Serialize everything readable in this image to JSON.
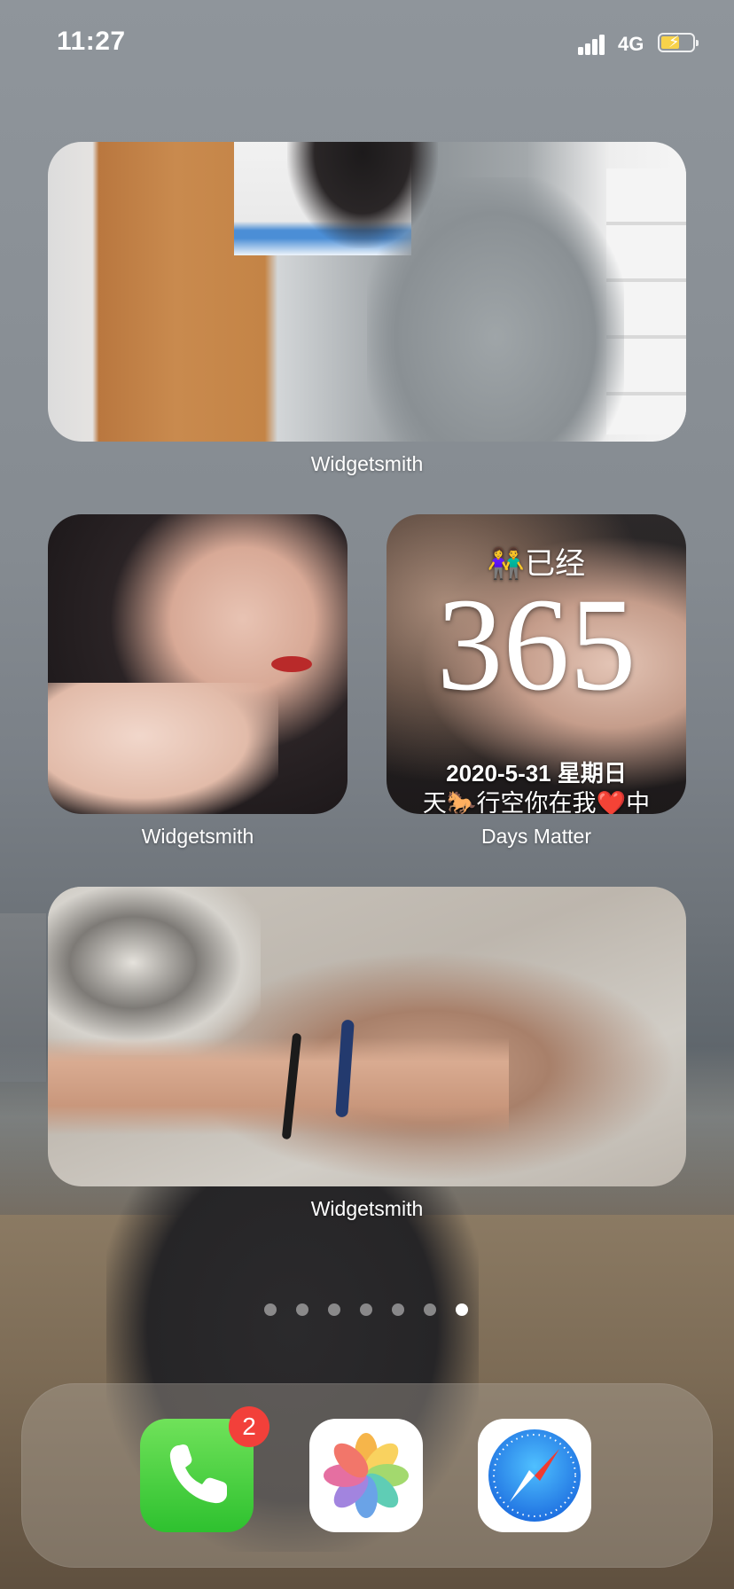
{
  "status_bar": {
    "time": "11:27",
    "network": "4G",
    "charging": true
  },
  "widgets": [
    {
      "label": "Widgetsmith",
      "app": "Widgetsmith"
    },
    {
      "label": "Widgetsmith",
      "app": "Widgetsmith"
    },
    {
      "label": "Days Matter",
      "app": "Days Matter",
      "emoji": "👫",
      "prefix": "已经",
      "count": "365",
      "date_line": "2020-5-31 星期日",
      "caption_start": "天",
      "caption_emoji_horse": "🐎",
      "caption_middle": "行空你在我",
      "caption_emoji_heart": "❤️",
      "caption_end": "中"
    },
    {
      "label": "Widgetsmith",
      "app": "Widgetsmith"
    }
  ],
  "page_dots": {
    "count": 7,
    "active_index": 6
  },
  "dock": {
    "apps": [
      {
        "name": "Phone",
        "icon": "phone-icon",
        "badge": "2"
      },
      {
        "name": "Photos",
        "icon": "photos-icon"
      },
      {
        "name": "Safari",
        "icon": "safari-icon"
      }
    ]
  },
  "colors": {
    "badge_red": "#f2403a",
    "phone_green": "#34c759",
    "safari_blue": "#1e8cf0",
    "battery_yellow": "#f7d24a"
  }
}
